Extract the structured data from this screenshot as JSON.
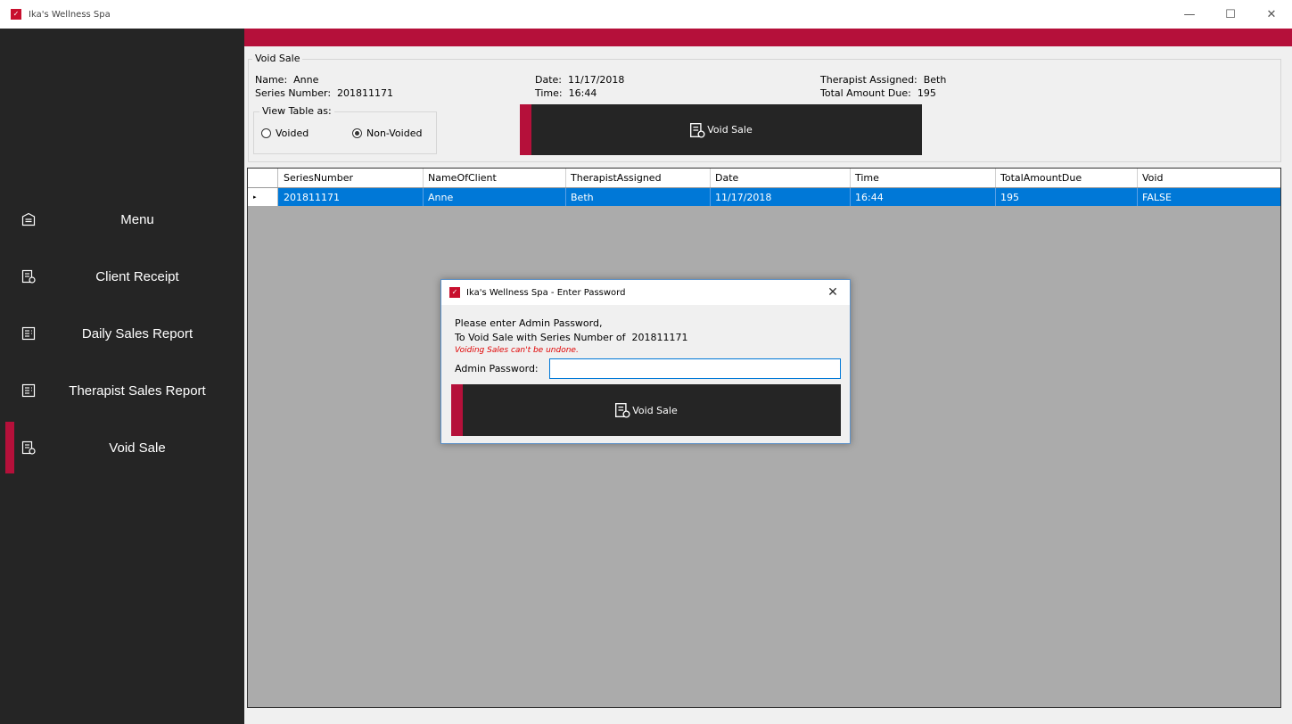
{
  "window": {
    "title": "Ika's Wellness Spa",
    "minimize": "—",
    "maximize": "☐",
    "close": "✕"
  },
  "sidebar": {
    "items": [
      {
        "label": "Menu",
        "icon": "menu-icon"
      },
      {
        "label": "Client Receipt",
        "icon": "receipt-icon"
      },
      {
        "label": "Daily Sales Report",
        "icon": "report-icon"
      },
      {
        "label": "Therapist Sales Report",
        "icon": "report-icon"
      },
      {
        "label": "Void Sale",
        "icon": "void-sale-icon",
        "active": true
      }
    ]
  },
  "void_sale": {
    "group_title": "Void Sale",
    "name": "Name:  Anne",
    "series_number": "Series Number:  201811171",
    "date": "Date:  11/17/2018",
    "time": "Time:  16:44",
    "therapist": "Therapist Assigned:  Beth",
    "total": "Total Amount Due:  195",
    "view_table_label": "View Table as:",
    "radio_voided": "Voided",
    "radio_non_voided": "Non-Voided",
    "selected_view": "Non-Voided",
    "button_label": "Void Sale"
  },
  "table": {
    "columns": [
      "SeriesNumber",
      "NameOfClient",
      "TherapistAssigned",
      "Date",
      "Time",
      "TotalAmountDue",
      "Void"
    ],
    "rows": [
      [
        "201811171",
        "Anne",
        "Beth",
        "11/17/2018",
        "16:44",
        "195",
        "FALSE"
      ]
    ],
    "row_indicator": "▸"
  },
  "dialog": {
    "title": "Ika's Wellness Spa - Enter Password",
    "close": "✕",
    "line1": "Please enter Admin Password,",
    "line2": "To Void Sale with Series Number of  201811171",
    "warning": "Voiding Sales can't be undone.",
    "password_label": "Admin Password:",
    "password_value": "",
    "button_label": "Void Sale"
  },
  "colors": {
    "accent": "#b5103a",
    "sidebar": "#252525",
    "selection": "#0078d7",
    "grid_background": "#ababab",
    "warning": "#e00000"
  }
}
